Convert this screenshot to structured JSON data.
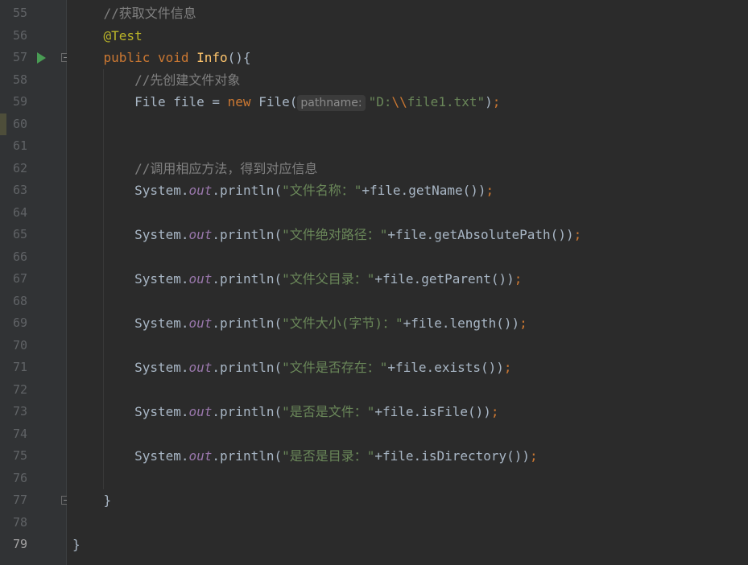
{
  "editor": {
    "current_line": "79",
    "lines": [
      {
        "no": "55",
        "tokens": [
          {
            "t": "    //获取文件信息",
            "c": "cm"
          }
        ]
      },
      {
        "no": "56",
        "tokens": [
          {
            "t": "    "
          },
          {
            "t": "@Test",
            "c": "anno"
          }
        ]
      },
      {
        "no": "57",
        "tokens": [
          {
            "t": "    "
          },
          {
            "t": "public void ",
            "c": "kw"
          },
          {
            "t": "Info",
            "c": "fn"
          },
          {
            "t": "(){"
          }
        ]
      },
      {
        "no": "58",
        "tokens": [
          {
            "t": "        //先创建文件对象",
            "c": "cm"
          }
        ]
      },
      {
        "no": "59",
        "tokens": [
          {
            "t": "        File file = "
          },
          {
            "t": "new ",
            "c": "kw"
          },
          {
            "t": "File("
          },
          {
            "t": "pathname:",
            "c": "hint"
          },
          {
            "t": "\"D:",
            "c": "str"
          },
          {
            "t": "\\\\",
            "c": "esc"
          },
          {
            "t": "file1.txt\"",
            "c": "str"
          },
          {
            "t": ")"
          },
          {
            "t": ";",
            "c": "kw"
          }
        ]
      },
      {
        "no": "60",
        "tokens": []
      },
      {
        "no": "61",
        "tokens": []
      },
      {
        "no": "62",
        "tokens": [
          {
            "t": "        //调用相应方法，得到对应信息",
            "c": "cm"
          }
        ]
      },
      {
        "no": "63",
        "tokens": [
          {
            "t": "        System."
          },
          {
            "t": "out",
            "c": "fld"
          },
          {
            "t": ".println("
          },
          {
            "t": "\"文件名称：\"",
            "c": "str"
          },
          {
            "t": "+file.getName())"
          },
          {
            "t": ";",
            "c": "kw"
          }
        ]
      },
      {
        "no": "64",
        "tokens": []
      },
      {
        "no": "65",
        "tokens": [
          {
            "t": "        System."
          },
          {
            "t": "out",
            "c": "fld"
          },
          {
            "t": ".println("
          },
          {
            "t": "\"文件绝对路径：\"",
            "c": "str"
          },
          {
            "t": "+file.getAbsolutePath())"
          },
          {
            "t": ";",
            "c": "kw"
          }
        ]
      },
      {
        "no": "66",
        "tokens": []
      },
      {
        "no": "67",
        "tokens": [
          {
            "t": "        System."
          },
          {
            "t": "out",
            "c": "fld"
          },
          {
            "t": ".println("
          },
          {
            "t": "\"文件父目录：\"",
            "c": "str"
          },
          {
            "t": "+file.getParent())"
          },
          {
            "t": ";",
            "c": "kw"
          }
        ]
      },
      {
        "no": "68",
        "tokens": []
      },
      {
        "no": "69",
        "tokens": [
          {
            "t": "        System."
          },
          {
            "t": "out",
            "c": "fld"
          },
          {
            "t": ".println("
          },
          {
            "t": "\"文件大小(字节)：\"",
            "c": "str"
          },
          {
            "t": "+file.length())"
          },
          {
            "t": ";",
            "c": "kw"
          }
        ]
      },
      {
        "no": "70",
        "tokens": []
      },
      {
        "no": "71",
        "tokens": [
          {
            "t": "        System."
          },
          {
            "t": "out",
            "c": "fld"
          },
          {
            "t": ".println("
          },
          {
            "t": "\"文件是否存在：\"",
            "c": "str"
          },
          {
            "t": "+file.exists())"
          },
          {
            "t": ";",
            "c": "kw"
          }
        ]
      },
      {
        "no": "72",
        "tokens": []
      },
      {
        "no": "73",
        "tokens": [
          {
            "t": "        System."
          },
          {
            "t": "out",
            "c": "fld"
          },
          {
            "t": ".println("
          },
          {
            "t": "\"是否是文件：\"",
            "c": "str"
          },
          {
            "t": "+file.isFile())"
          },
          {
            "t": ";",
            "c": "kw"
          }
        ]
      },
      {
        "no": "74",
        "tokens": []
      },
      {
        "no": "75",
        "tokens": [
          {
            "t": "        System."
          },
          {
            "t": "out",
            "c": "fld"
          },
          {
            "t": ".println("
          },
          {
            "t": "\"是否是目录：\"",
            "c": "str"
          },
          {
            "t": "+file.isDirectory())"
          },
          {
            "t": ";",
            "c": "kw"
          }
        ]
      },
      {
        "no": "76",
        "tokens": []
      },
      {
        "no": "77",
        "tokens": [
          {
            "t": "    }"
          }
        ]
      },
      {
        "no": "78",
        "tokens": []
      },
      {
        "no": "79",
        "tokens": [
          {
            "t": "}"
          }
        ]
      }
    ]
  },
  "colors": {
    "background": "#2b2b2b",
    "gutter": "#313335",
    "keyword": "#cc7832",
    "string": "#6a8759",
    "comment": "#808080",
    "annotation": "#bbb529",
    "method_decl": "#ffc66d",
    "static_field": "#9876aa",
    "run_icon": "#499c54"
  },
  "icons": {
    "run": "run-gutter-icon",
    "fold": "fold-icon"
  }
}
